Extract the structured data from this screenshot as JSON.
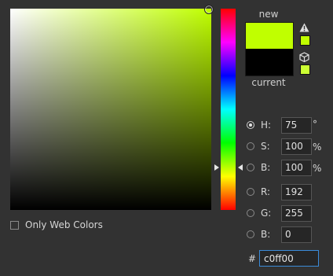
{
  "preview": {
    "new_label": "new",
    "current_label": "current",
    "new_color": "#c0ff00",
    "current_color": "#000000",
    "gamut_warning_color": "#c0ff00",
    "web_safe_color": "#ccff33"
  },
  "fields": {
    "h": {
      "label": "H:",
      "value": "75",
      "unit": "°"
    },
    "s": {
      "label": "S:",
      "value": "100",
      "unit": "%"
    },
    "b_hsb": {
      "label": "B:",
      "value": "100",
      "unit": "%"
    },
    "r": {
      "label": "R:",
      "value": "192"
    },
    "g": {
      "label": "G:",
      "value": "255"
    },
    "b_rgb": {
      "label": "B:",
      "value": "0"
    }
  },
  "hex": {
    "prefix": "#",
    "value": "c0ff00"
  },
  "only_web_colors_label": "Only Web Colors",
  "selected_mode": "H",
  "hue_degrees": 75
}
